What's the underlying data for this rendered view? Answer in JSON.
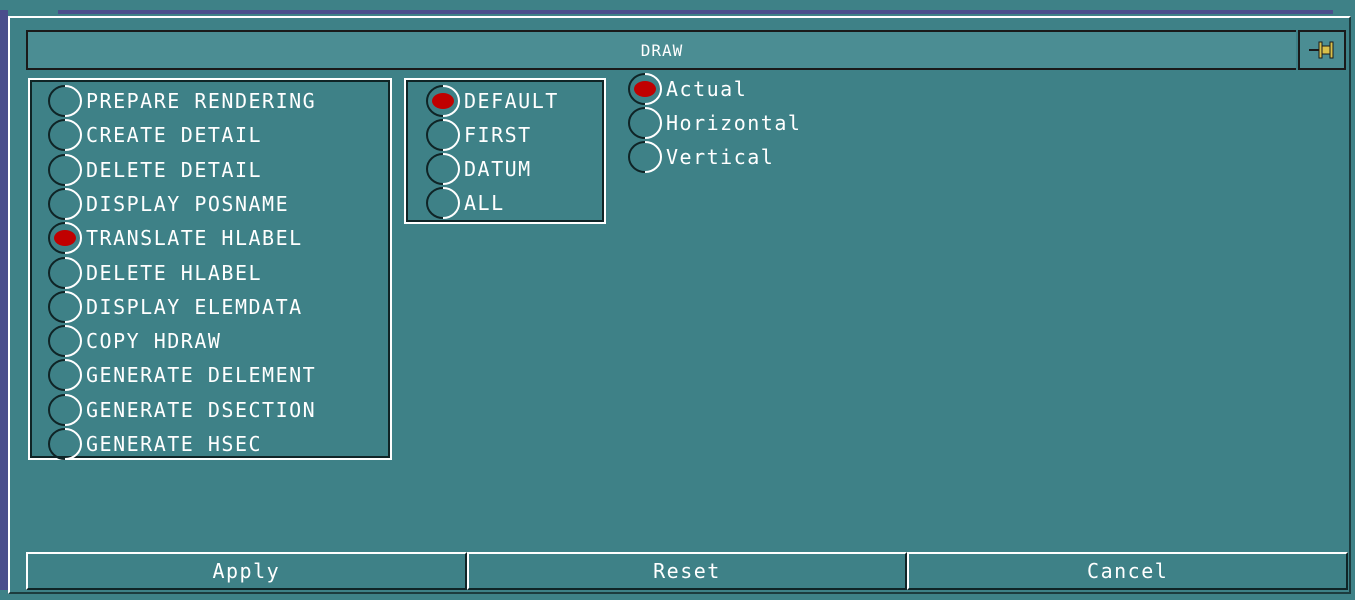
{
  "window": {
    "title": "DRAW"
  },
  "actions": {
    "items": [
      {
        "label": "PREPARE RENDERING",
        "selected": false
      },
      {
        "label": "CREATE DETAIL",
        "selected": false
      },
      {
        "label": "DELETE DETAIL",
        "selected": false
      },
      {
        "label": "DISPLAY POSNAME",
        "selected": false
      },
      {
        "label": "TRANSLATE HLABEL",
        "selected": true
      },
      {
        "label": "DELETE HLABEL",
        "selected": false
      },
      {
        "label": "DISPLAY ELEMDATA",
        "selected": false
      },
      {
        "label": "COPY HDRAW",
        "selected": false
      },
      {
        "label": "GENERATE DELEMENT",
        "selected": false
      },
      {
        "label": "GENERATE DSECTION",
        "selected": false
      },
      {
        "label": "GENERATE HSEC",
        "selected": false
      }
    ]
  },
  "mode": {
    "items": [
      {
        "label": "DEFAULT",
        "selected": true
      },
      {
        "label": "FIRST",
        "selected": false
      },
      {
        "label": "DATUM",
        "selected": false
      },
      {
        "label": "ALL",
        "selected": false
      }
    ]
  },
  "orientation": {
    "items": [
      {
        "label": "Actual",
        "selected": true
      },
      {
        "label": "Horizontal",
        "selected": false
      },
      {
        "label": "Vertical",
        "selected": false
      }
    ]
  },
  "buttons": {
    "apply": "Apply",
    "reset": "Reset",
    "cancel": "Cancel"
  },
  "colors": {
    "background": "#3e8187",
    "selected_dot": "#c00000",
    "text": "#ffffff",
    "title_bg": "#4b8d93"
  },
  "icons": {
    "pin": "pin-icon"
  }
}
